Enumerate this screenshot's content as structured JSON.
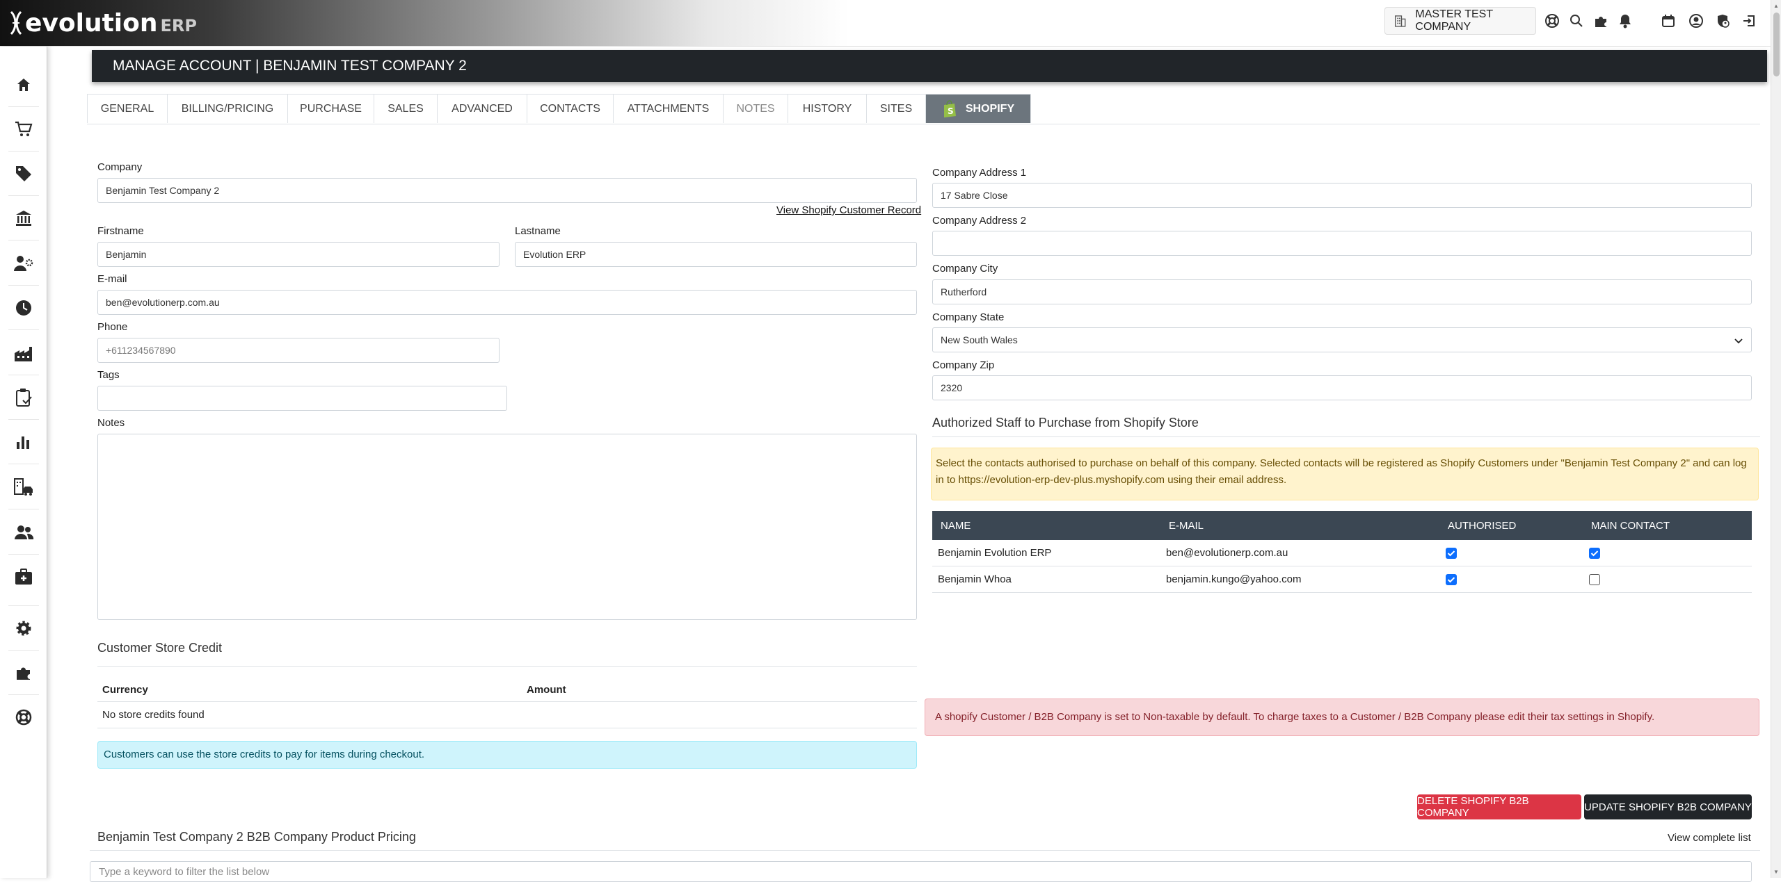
{
  "app": {
    "logo_word": "evolution",
    "logo_suffix": "ERP"
  },
  "topbar": {
    "company_name": "MASTER TEST COMPANY",
    "icons": [
      "building-icon",
      "support-icon",
      "search-icon",
      "plugin-icon",
      "bell-icon",
      "calendar-icon",
      "user-icon",
      "shield-user-icon",
      "logout-icon"
    ]
  },
  "sidebar": {
    "items": [
      "home-icon",
      "cart-icon",
      "tag-icon",
      "bank-icon",
      "user-cog-icon",
      "clock-icon",
      "factory-icon",
      "clipboard-check-icon",
      "bar-chart-icon",
      "building-car-icon",
      "users-icon",
      "id-badge-icon",
      "gear-icon",
      "plugin-icon",
      "support-icon"
    ]
  },
  "header": {
    "title": "MANAGE ACCOUNT | BENJAMIN TEST COMPANY 2"
  },
  "tabs": [
    {
      "label": "GENERAL"
    },
    {
      "label": "BILLING/PRICING"
    },
    {
      "label": "PURCHASE"
    },
    {
      "label": "SALES"
    },
    {
      "label": "ADVANCED"
    },
    {
      "label": "CONTACTS"
    },
    {
      "label": "ATTACHMENTS"
    },
    {
      "label": "NOTES"
    },
    {
      "label": "HISTORY"
    },
    {
      "label": "SITES"
    },
    {
      "label": "SHOPIFY"
    }
  ],
  "form": {
    "company_label": "Company",
    "company_value": "Benjamin Test Company 2",
    "view_shopify_link": "View Shopify Customer Record",
    "firstname_label": "Firstname",
    "firstname_value": "Benjamin",
    "lastname_label": "Lastname",
    "lastname_value": "Evolution ERP",
    "email_label": "E-mail",
    "email_value": "ben@evolutionerp.com.au",
    "phone_label": "Phone",
    "phone_placeholder": "+611234567890",
    "tags_label": "Tags",
    "notes_label": "Notes",
    "address1_label": "Company Address 1",
    "address1_value": "17 Sabre Close",
    "address2_label": "Company Address 2",
    "address2_value": "",
    "city_label": "Company City",
    "city_value": "Rutherford",
    "state_label": "Company State",
    "state_value": "New South Wales",
    "zip_label": "Company Zip",
    "zip_value": "2320"
  },
  "authorized": {
    "title": "Authorized Staff to Purchase from Shopify Store",
    "notice": "Select the contacts authorised to purchase on behalf of this company. Selected contacts will be registered as Shopify Customers under \"Benjamin Test Company 2\" and can log in to https://evolution-erp-dev-plus.myshopify.com using their email address.",
    "columns": [
      "NAME",
      "E-MAIL",
      "AUTHORISED",
      "MAIN CONTACT"
    ],
    "rows": [
      {
        "name": "Benjamin Evolution ERP",
        "email": "ben@evolutionerp.com.au",
        "authorised": true,
        "main_contact": true
      },
      {
        "name": "Benjamin Whoa",
        "email": "benjamin.kungo@yahoo.com",
        "authorised": true,
        "main_contact": false
      }
    ]
  },
  "store_credit": {
    "title": "Customer Store Credit",
    "columns": [
      "Currency",
      "Amount"
    ],
    "empty_text": "No store credits found",
    "info": "Customers can use the store credits to pay for items during checkout."
  },
  "tax_notice": "A shopify Customer / B2B Company is set to Non-taxable by default.  To charge taxes to a Customer / B2B Company please edit their tax settings in Shopify.",
  "actions": {
    "delete_label": "DELETE SHOPIFY B2B COMPANY",
    "update_label": "UPDATE SHOPIFY B2B COMPANY"
  },
  "pricing": {
    "title": "Benjamin Test Company 2 B2B Company Product Pricing",
    "view_list_link": "View complete list",
    "filter_placeholder": "Type a keyword to filter the list below"
  },
  "colors": {
    "header_bg": "#212529",
    "active_tab": "#6c757d",
    "table_head": "#3b4753",
    "checkbox": "#0d6efd",
    "danger": "#dc3545"
  }
}
